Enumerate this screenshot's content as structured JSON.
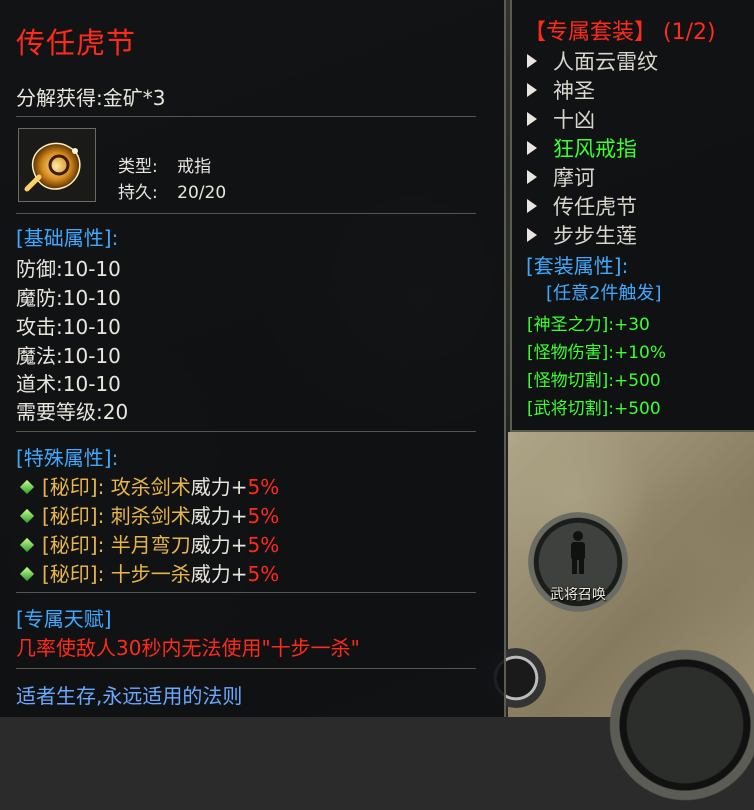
{
  "item": {
    "name": "传任虎节",
    "decompose": "分解获得:金矿*3",
    "type_label": "类型:",
    "type_value": "戒指",
    "durability_label": "持久:",
    "durability_value": "20/20"
  },
  "base_attrs": {
    "header": "[基础属性]:",
    "rows": [
      {
        "label": "防御:",
        "value": "10-10"
      },
      {
        "label": "魔防:",
        "value": "10-10"
      },
      {
        "label": "攻击:",
        "value": "10-10"
      },
      {
        "label": "魔法:",
        "value": "10-10"
      },
      {
        "label": "道术:",
        "value": "10-10"
      },
      {
        "label": "需要等级:",
        "value": "20"
      }
    ]
  },
  "special_attrs": {
    "header": "[特殊属性]:",
    "rows": [
      {
        "seal": "[秘印]:",
        "skill": "攻杀剑术",
        "power": "威力+",
        "pct": "5%"
      },
      {
        "seal": "[秘印]:",
        "skill": "刺杀剑术",
        "power": "威力+",
        "pct": "5%"
      },
      {
        "seal": "[秘印]:",
        "skill": "半月弯刀",
        "power": "威力+",
        "pct": "5%"
      },
      {
        "seal": "[秘印]:",
        "skill": "十步一杀",
        "power": "威力+",
        "pct": "5%"
      }
    ]
  },
  "talent": {
    "header": "[专属天赋]",
    "desc": "几率使敌人30秒内无法使用\"十步一杀\""
  },
  "motto": "适者生存,永远适用的法则",
  "set": {
    "title": "【专属套装】",
    "count": "(1/2)",
    "items": [
      {
        "name": "人面云雷纹",
        "owned": false
      },
      {
        "name": "神圣",
        "owned": false
      },
      {
        "name": "十凶",
        "owned": false
      },
      {
        "name": "狂风戒指",
        "owned": true
      },
      {
        "name": "摩诃",
        "owned": false
      },
      {
        "name": "传任虎节",
        "owned": false
      },
      {
        "name": "步步生莲",
        "owned": false
      }
    ],
    "attr_header": "[套装属性]:",
    "trigger": "[任意2件触发]",
    "bonuses": [
      "[神圣之力]:+30",
      "[怪物伤害]:+10%",
      "[怪物切割]:+500",
      "[武将切割]:+500"
    ]
  },
  "map_button": {
    "label": "武将召唤"
  },
  "colors": {
    "title_red": "#ff2a1a",
    "section_blue": "#3fa9ff",
    "set_green": "#3bff2f",
    "seal_gold": "#e8b548"
  }
}
